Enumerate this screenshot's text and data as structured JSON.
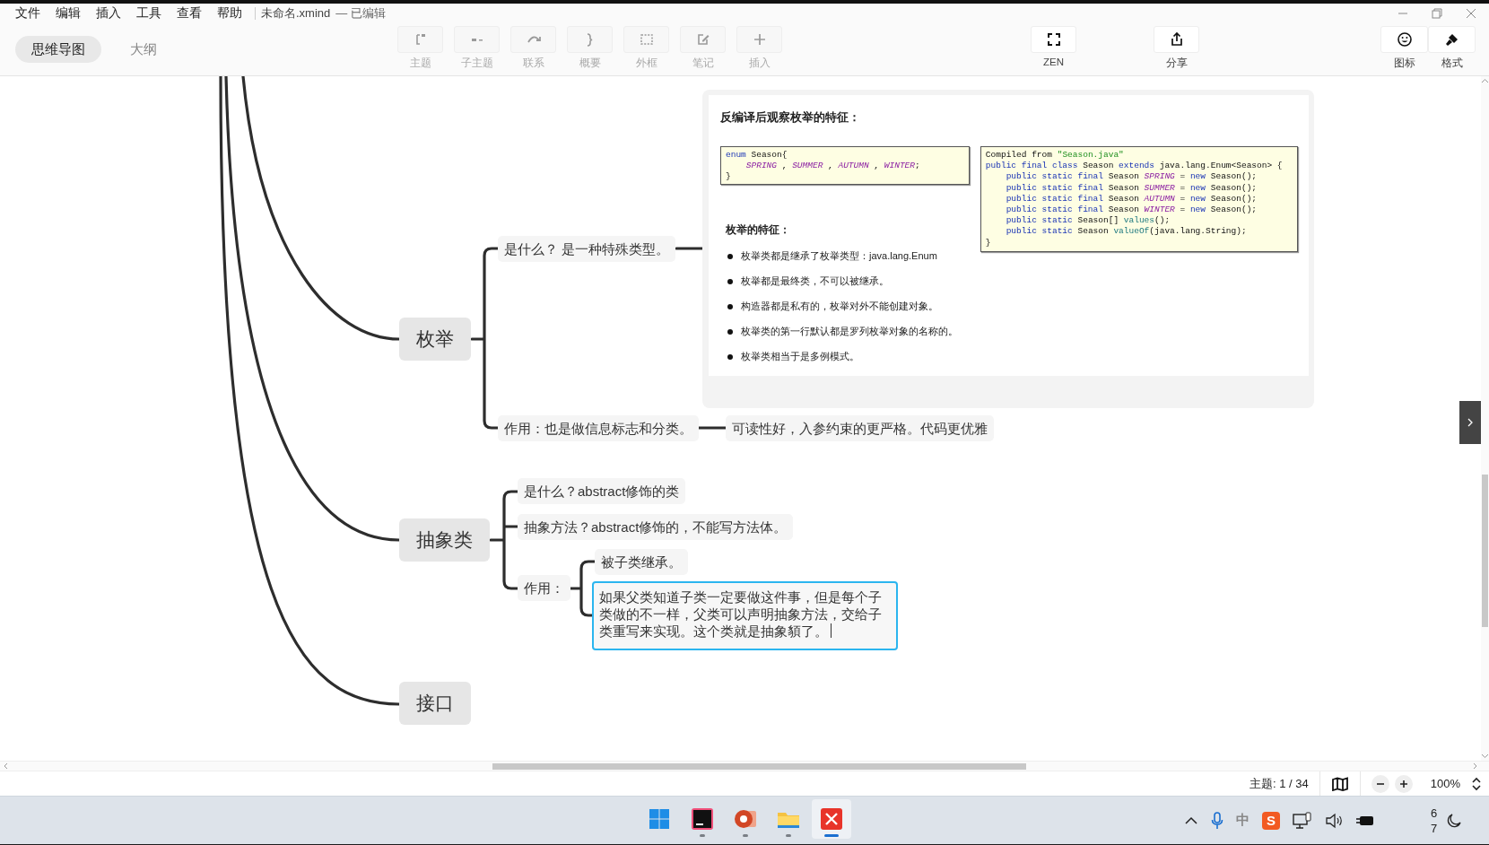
{
  "menu": [
    "文件",
    "编辑",
    "插入",
    "工具",
    "查看",
    "帮助"
  ],
  "document": {
    "title": "未命名.xmind",
    "status": "— 已编辑"
  },
  "view_tabs": [
    {
      "label": "思维导图",
      "selected": true
    },
    {
      "label": "大纲",
      "selected": false
    }
  ],
  "tool_groups": [
    {
      "items": [
        {
          "kind": "topic",
          "label": "主题",
          "disabled": true
        },
        {
          "kind": "subtopic",
          "label": "子主题",
          "disabled": true
        },
        {
          "kind": "relationship",
          "label": "联系",
          "disabled": true
        },
        {
          "kind": "summary",
          "label": "概要",
          "disabled": true
        },
        {
          "kind": "boundary",
          "label": "外框",
          "disabled": true
        },
        {
          "kind": "note",
          "label": "笔记",
          "disabled": true
        },
        {
          "kind": "insert",
          "label": "插入",
          "disabled": true
        }
      ]
    },
    {
      "items": [
        {
          "kind": "zen",
          "label": "ZEN",
          "disabled": false
        }
      ]
    },
    {
      "items": [
        {
          "kind": "share",
          "label": "分享",
          "disabled": false
        }
      ]
    },
    {
      "items": [
        {
          "kind": "icon",
          "label": "图标",
          "disabled": false
        },
        {
          "kind": "format",
          "label": "格式",
          "disabled": false
        }
      ]
    }
  ],
  "mind_map": {
    "branches": [
      {
        "label": "枚举",
        "children": [
          {
            "label": "是什么？ 是一种特殊类型。",
            "editing": false,
            "attachment": {
              "heading": "反编译后观察枚举的特征：",
              "code_blocks": [
                {
                  "lines": [
                    [
                      {
                        "kind": "keyword",
                        "text": "enum"
                      },
                      {
                        "kind": "plain",
                        "text": " Season{"
                      }
                    ],
                    [
                      {
                        "kind": "indent"
                      },
                      {
                        "kind": "constant",
                        "text": "SPRING"
                      },
                      {
                        "kind": "plain",
                        "text": " , "
                      },
                      {
                        "kind": "constant",
                        "text": "SUMMER"
                      },
                      {
                        "kind": "plain",
                        "text": " , "
                      },
                      {
                        "kind": "constant",
                        "text": "AUTUMN"
                      },
                      {
                        "kind": "plain",
                        "text": " , "
                      },
                      {
                        "kind": "constant",
                        "text": "WINTER"
                      },
                      {
                        "kind": "plain",
                        "text": ";"
                      }
                    ],
                    [
                      {
                        "kind": "plain",
                        "text": "}"
                      }
                    ]
                  ]
                },
                {
                  "lines": [
                    [
                      {
                        "kind": "plain",
                        "text": "Compiled from "
                      },
                      {
                        "kind": "string",
                        "text": "\"Season.java\""
                      }
                    ],
                    [
                      {
                        "kind": "keyword",
                        "text": "public final class"
                      },
                      {
                        "kind": "plain",
                        "text": " Season "
                      },
                      {
                        "kind": "keyword",
                        "text": "extends"
                      },
                      {
                        "kind": "plain",
                        "text": " java.lang.Enum<Season> {"
                      }
                    ],
                    [
                      {
                        "kind": "indent"
                      },
                      {
                        "kind": "keyword",
                        "text": "public static final"
                      },
                      {
                        "kind": "plain",
                        "text": " Season "
                      },
                      {
                        "kind": "constant",
                        "text": "SPRING"
                      },
                      {
                        "kind": "plain",
                        "text": " = "
                      },
                      {
                        "kind": "keyword",
                        "text": "new"
                      },
                      {
                        "kind": "plain",
                        "text": " Season();"
                      }
                    ],
                    [
                      {
                        "kind": "indent"
                      },
                      {
                        "kind": "keyword",
                        "text": "public static final"
                      },
                      {
                        "kind": "plain",
                        "text": " Season "
                      },
                      {
                        "kind": "constant",
                        "text": "SUMMER"
                      },
                      {
                        "kind": "plain",
                        "text": " = "
                      },
                      {
                        "kind": "keyword",
                        "text": "new"
                      },
                      {
                        "kind": "plain",
                        "text": " Season();"
                      }
                    ],
                    [
                      {
                        "kind": "indent"
                      },
                      {
                        "kind": "keyword",
                        "text": "public static final"
                      },
                      {
                        "kind": "plain",
                        "text": " Season "
                      },
                      {
                        "kind": "constant",
                        "text": "AUTUMN"
                      },
                      {
                        "kind": "plain",
                        "text": " = "
                      },
                      {
                        "kind": "keyword",
                        "text": "new"
                      },
                      {
                        "kind": "plain",
                        "text": " Season();"
                      }
                    ],
                    [
                      {
                        "kind": "indent"
                      },
                      {
                        "kind": "keyword",
                        "text": "public static final"
                      },
                      {
                        "kind": "plain",
                        "text": " Season "
                      },
                      {
                        "kind": "constant",
                        "text": "WINTER"
                      },
                      {
                        "kind": "plain",
                        "text": " = "
                      },
                      {
                        "kind": "keyword",
                        "text": "new"
                      },
                      {
                        "kind": "plain",
                        "text": " Season();"
                      }
                    ],
                    [
                      {
                        "kind": "indent"
                      },
                      {
                        "kind": "keyword",
                        "text": "public static"
                      },
                      {
                        "kind": "plain",
                        "text": " Season[] "
                      },
                      {
                        "kind": "method",
                        "text": "values"
                      },
                      {
                        "kind": "plain",
                        "text": "();"
                      }
                    ],
                    [
                      {
                        "kind": "indent"
                      },
                      {
                        "kind": "keyword",
                        "text": "public static"
                      },
                      {
                        "kind": "plain",
                        "text": " Season "
                      },
                      {
                        "kind": "method",
                        "text": "valueOf"
                      },
                      {
                        "kind": "plain",
                        "text": "(java.lang.String);"
                      }
                    ],
                    [
                      {
                        "kind": "plain",
                        "text": "}"
                      }
                    ]
                  ]
                }
              ],
              "subheading": "枚举的特征：",
              "bullets": [
                "枚举类都是继承了枚举类型：java.lang.Enum",
                "枚举都是最终类，不可以被继承。",
                "构造器都是私有的，枚举对外不能创建对象。",
                "枚举类的第一行默认都是罗列枚举对象的名称的。",
                "枚举类相当于是多例模式。"
              ]
            }
          },
          {
            "label": "作用：也是做信息标志和分类。",
            "editing": false,
            "children": [
              {
                "label": "可读性好，入参约束的更严格。代码更优雅",
                "editing": false
              }
            ]
          }
        ]
      },
      {
        "label": "抽象类",
        "children": [
          {
            "label": "是什么？abstract修饰的类",
            "editing": false
          },
          {
            "label": "抽象方法？abstract修饰的，不能写方法体。",
            "editing": false
          },
          {
            "label": "作用：",
            "editing": false,
            "children": [
              {
                "label": "被子类继承。",
                "editing": false
              },
              {
                "label": "如果父类知道子类一定要做这件事，但是每个子类做的不一样，父类可以声明抽象方法，交给子类重写来实现。这个类就是抽象䫉了。",
                "editing": true
              }
            ]
          }
        ]
      },
      {
        "label": "接口"
      }
    ]
  },
  "status_bar": {
    "topic_count": "主题: 1 / 34",
    "zoom": "100%"
  },
  "taskbar": {
    "apps": [
      {
        "kind": "start",
        "running": false,
        "selected": false
      },
      {
        "kind": "ide",
        "running": true,
        "selected": false
      },
      {
        "kind": "slides",
        "running": true,
        "selected": false
      },
      {
        "kind": "files",
        "running": true,
        "selected": false
      },
      {
        "kind": "mindmap",
        "running": true,
        "selected": true
      }
    ],
    "ime": "中",
    "ime_logo": "S",
    "clock": [
      "6",
      "7"
    ]
  }
}
